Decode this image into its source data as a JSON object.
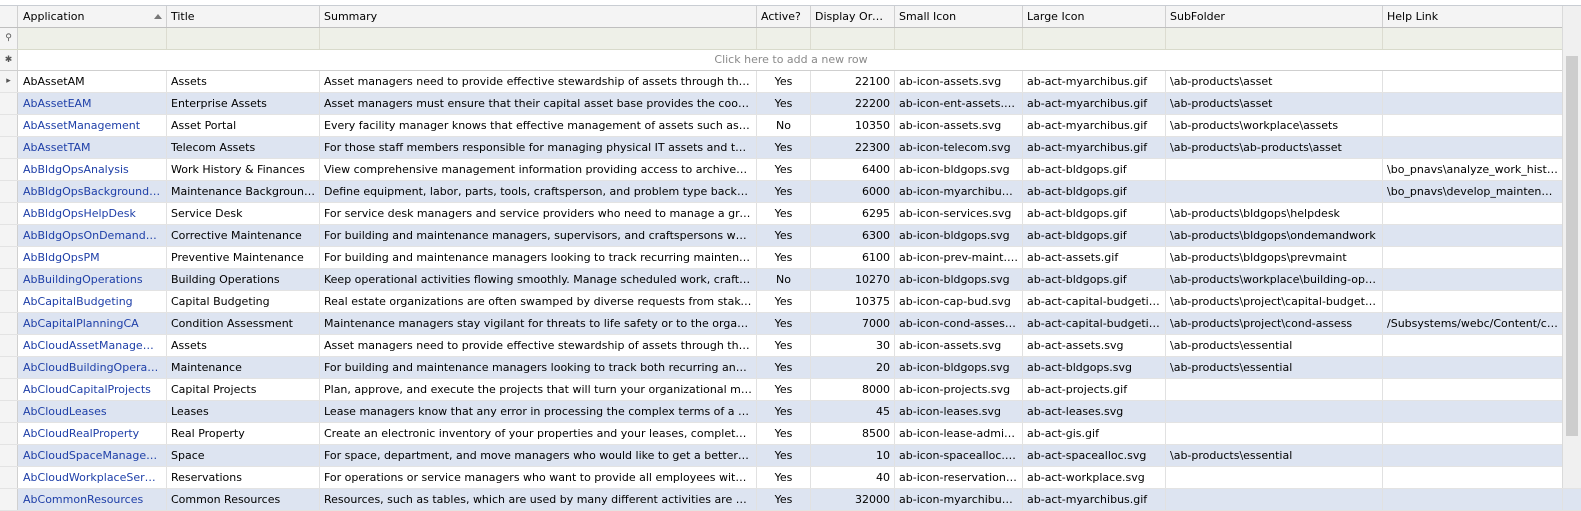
{
  "columns": [
    {
      "key": "application",
      "label": "Application"
    },
    {
      "key": "title",
      "label": "Title"
    },
    {
      "key": "summary",
      "label": "Summary"
    },
    {
      "key": "active",
      "label": "Active?"
    },
    {
      "key": "order",
      "label": "Display Order"
    },
    {
      "key": "small_icon",
      "label": "Small Icon"
    },
    {
      "key": "large_icon",
      "label": "Large Icon"
    },
    {
      "key": "subfolder",
      "label": "SubFolder"
    },
    {
      "key": "help",
      "label": "Help Link"
    }
  ],
  "new_row_text": "Click here to add a new row",
  "rows": [
    {
      "application": "AbAssetAM",
      "title": "Assets",
      "summary": "Asset managers need to provide effective stewardship of assets through their full oper...",
      "active": "Yes",
      "order": "22100",
      "small_icon": "ab-icon-assets.svg",
      "large_icon": "ab-act-myarchibus.gif",
      "subfolder": "\\ab-products\\asset",
      "help": ""
    },
    {
      "application": "AbAssetEAM",
      "title": "Enterprise Assets",
      "summary": "Asset managers must ensure that their capital asset base provides the coordinated, en...",
      "active": "Yes",
      "order": "22200",
      "small_icon": "ab-icon-ent-assets.svg",
      "large_icon": "ab-act-myarchibus.gif",
      "subfolder": "\\ab-products\\asset",
      "help": ""
    },
    {
      "application": "AbAssetManagement",
      "title": "Asset Portal",
      "summary": "Every facility manager knows that effective management of assets such as furniture, e...",
      "active": "No",
      "order": "10350",
      "small_icon": "ab-icon-assets.svg",
      "large_icon": "ab-act-myarchibus.gif",
      "subfolder": "\\ab-products\\workplace\\assets",
      "help": ""
    },
    {
      "application": "AbAssetTAM",
      "title": "Telecom Assets",
      "summary": "For those staff members responsible for managing physical IT assets and their connecti...",
      "active": "Yes",
      "order": "22300",
      "small_icon": "ab-icon-telecom.svg",
      "large_icon": "ab-act-myarchibus.gif",
      "subfolder": "\\ab-products\\ab-products\\asset",
      "help": ""
    },
    {
      "application": "AbBldgOpsAnalysis",
      "title": "Work History & Finances",
      "summary": "View comprehensive management information providing access to archived work orders ...",
      "active": "Yes",
      "order": "6400",
      "small_icon": "ab-icon-bldgops.svg",
      "large_icon": "ab-act-bldgops.gif",
      "subfolder": "",
      "help": "\\bo_pnavs\\analyze_work_history_"
    },
    {
      "application": "AbBldgOpsBackgroundData",
      "title": "Maintenance Background Data",
      "summary": "Define equipment, labor, parts, tools, craftsperson, and problem type background data.",
      "active": "Yes",
      "order": "6000",
      "small_icon": "ab-icon-myarchibus.svg",
      "large_icon": "ab-act-bldgops.gif",
      "subfolder": "",
      "help": "\\bo_pnavs\\develop_maintenance_"
    },
    {
      "application": "AbBldgOpsHelpDesk",
      "title": "Service Desk",
      "summary": "For service desk managers and service providers who need to manage a growing numbe...",
      "active": "Yes",
      "order": "6295",
      "small_icon": "ab-icon-services.svg",
      "large_icon": "ab-act-bldgops.gif",
      "subfolder": "\\ab-products\\bldgops\\helpdesk",
      "help": ""
    },
    {
      "application": "AbBldgOpsOnDemandWork",
      "title": "Corrective Maintenance",
      "summary": "For building and maintenance managers, supervisors, and craftspersons who need to tr...",
      "active": "Yes",
      "order": "6300",
      "small_icon": "ab-icon-bldgops.svg",
      "large_icon": "ab-act-bldgops.gif",
      "subfolder": "\\ab-products\\bldgops\\ondemandwork",
      "help": ""
    },
    {
      "application": "AbBldgOpsPM",
      "title": "Preventive Maintenance",
      "summary": "For building and maintenance managers looking to track recurring maintenance work mor...",
      "active": "Yes",
      "order": "6100",
      "small_icon": "ab-icon-prev-maint.svg",
      "large_icon": "ab-act-assets.gif",
      "subfolder": "\\ab-products\\bldgops\\prevmaint",
      "help": ""
    },
    {
      "application": "AbBuildingOperations",
      "title": "Building Operations",
      "summary": "Keep operational activities flowing smoothly. Manage scheduled work, craftspersons, to...",
      "active": "No",
      "order": "10270",
      "small_icon": "ab-icon-bldgops.svg",
      "large_icon": "ab-act-bldgops.gif",
      "subfolder": "\\ab-products\\workplace\\building-operations",
      "help": ""
    },
    {
      "application": "AbCapitalBudgeting",
      "title": "Capital Budgeting",
      "summary": "Real estate organizations are often swamped by diverse requests from stakeholders thr...",
      "active": "Yes",
      "order": "10375",
      "small_icon": "ab-icon-cap-bud.svg",
      "large_icon": "ab-act-capital-budgeting.gif",
      "subfolder": "\\ab-products\\project\\capital-budgeting",
      "help": ""
    },
    {
      "application": "AbCapitalPlanningCA",
      "title": "Condition Assessment",
      "summary": "Maintenance managers stay vigilant for threats to life safety or to the organization's mis...",
      "active": "Yes",
      "order": "7000",
      "small_icon": "ab-icon-cond-assess.svg",
      "large_icon": "ab-act-capital-budgeting.gif",
      "subfolder": "\\ab-products\\project\\cond-assess",
      "help": "/Subsystems/webc/Content/ca/cor"
    },
    {
      "application": "AbCloudAssetManagement",
      "title": "Assets",
      "summary": "Asset managers need to provide effective stewardship of assets through their full oper...",
      "active": "Yes",
      "order": "30",
      "small_icon": "ab-icon-assets.svg",
      "large_icon": "ab-act-assets.svg",
      "subfolder": "\\ab-products\\essential",
      "help": ""
    },
    {
      "application": "AbCloudBuildingOperations",
      "title": "Maintenance",
      "summary": "For building and maintenance managers looking to track both recurring and corrective m...",
      "active": "Yes",
      "order": "20",
      "small_icon": "ab-icon-bldgops.svg",
      "large_icon": "ab-act-bldgops.svg",
      "subfolder": "\\ab-products\\essential",
      "help": ""
    },
    {
      "application": "AbCloudCapitalProjects",
      "title": "Capital Projects",
      "summary": "Plan, approve, and execute the projects that will turn your organizational mission goals i...",
      "active": "Yes",
      "order": "8000",
      "small_icon": "ab-icon-projects.svg",
      "large_icon": "ab-act-projects.gif",
      "subfolder": "",
      "help": ""
    },
    {
      "application": "AbCloudLeases",
      "title": "Leases",
      "summary": "Lease managers know that any error in processing the complex terms of a lease can res...",
      "active": "Yes",
      "order": "45",
      "small_icon": "ab-icon-leases.svg",
      "large_icon": "ab-act-leases.svg",
      "subfolder": "",
      "help": ""
    },
    {
      "application": "AbCloudRealProperty",
      "title": "Real Property",
      "summary": "Create an electronic inventory of your properties and your leases, complete with detaile...",
      "active": "Yes",
      "order": "8500",
      "small_icon": "ab-icon-lease-admin.svg",
      "large_icon": "ab-act-gis.gif",
      "subfolder": "",
      "help": ""
    },
    {
      "application": "AbCloudSpaceManagement",
      "title": "Space",
      "summary": "For space, department, and move managers who would like to get a better handle on th...",
      "active": "Yes",
      "order": "10",
      "small_icon": "ab-icon-spacealloc.svg",
      "large_icon": "ab-act-spacealloc.svg",
      "subfolder": "\\ab-products\\essential",
      "help": ""
    },
    {
      "application": "AbCloudWorkplaceServices",
      "title": "Reservations",
      "summary": "For operations or service managers who want to provide all employees with the ability t...",
      "active": "Yes",
      "order": "40",
      "small_icon": "ab-icon-reservations.svg",
      "large_icon": "ab-act-workplace.svg",
      "subfolder": "",
      "help": ""
    },
    {
      "application": "AbCommonResources",
      "title": "Common Resources",
      "summary": "Resources, such as tables, which are used by many different activities are assigned to t...",
      "active": "Yes",
      "order": "32000",
      "small_icon": "ab-icon-myarchibus.svg",
      "large_icon": "ab-act-myarchibus.gif",
      "subfolder": "",
      "help": ""
    }
  ]
}
